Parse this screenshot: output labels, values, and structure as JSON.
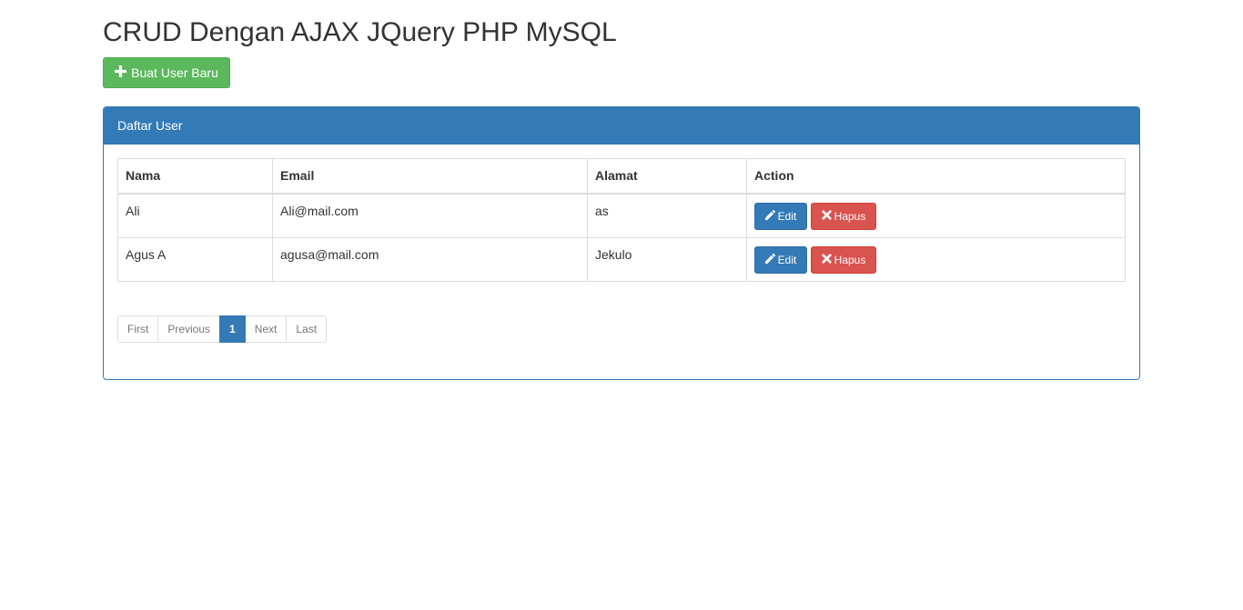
{
  "page": {
    "title": "CRUD Dengan AJAX JQuery PHP MySQL",
    "create_button_label": "Buat User Baru"
  },
  "panel": {
    "heading": "Daftar User"
  },
  "table": {
    "headers": [
      "Nama",
      "Email",
      "Alamat",
      "Action"
    ],
    "rows": [
      {
        "nama": "Ali",
        "email": "Ali@mail.com",
        "alamat": "as",
        "edit_label": "Edit",
        "delete_label": "Hapus"
      },
      {
        "nama": "Agus A",
        "email": "agusa@mail.com",
        "alamat": "Jekulo",
        "edit_label": "Edit",
        "delete_label": "Hapus"
      }
    ]
  },
  "pagination": {
    "first": "First",
    "previous": "Previous",
    "current": "1",
    "next": "Next",
    "last": "Last"
  },
  "colors": {
    "primary": "#337ab7",
    "success": "#5cb85c",
    "danger": "#d9534f"
  },
  "icons": {
    "create": "plus-icon",
    "edit": "pencil-icon",
    "delete": "times-icon"
  }
}
